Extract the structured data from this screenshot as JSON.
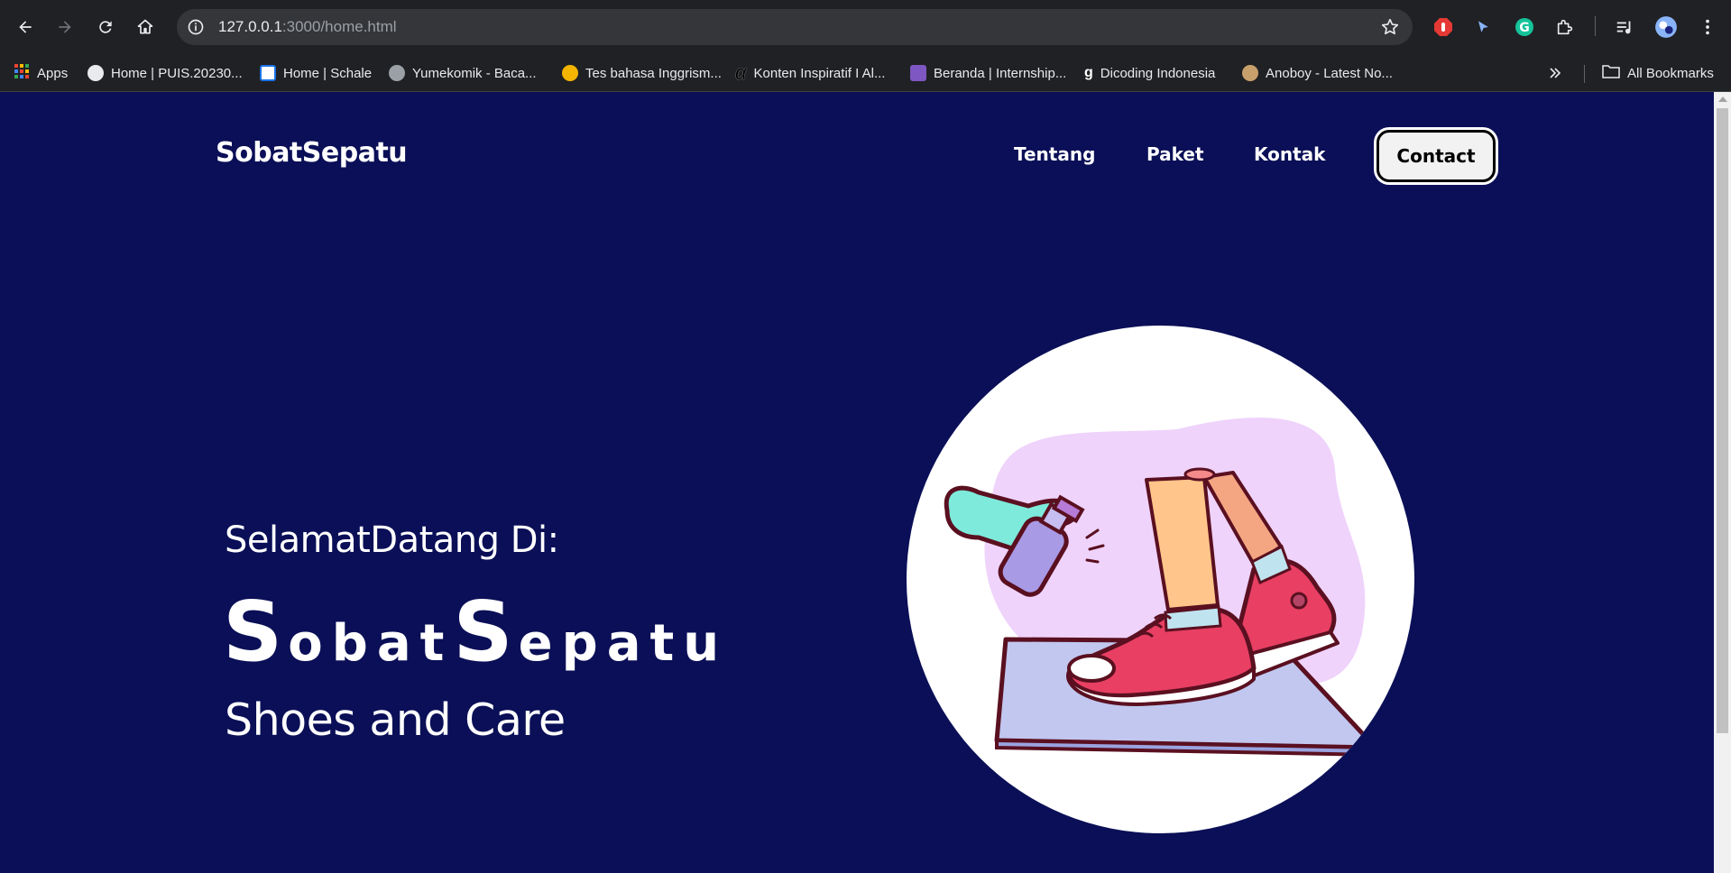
{
  "browser": {
    "url_host": "127.0.0.1",
    "url_path": ":3000/home.html",
    "bookmarks": [
      {
        "label": "Apps",
        "color": "#4285f4"
      },
      {
        "label": "Home | PUIS.20230...",
        "color": "#e8eaed"
      },
      {
        "label": "Home | Schale",
        "color": "#1a73e8"
      },
      {
        "label": "Yumekomik - Baca...",
        "color": "#9aa0a6"
      },
      {
        "label": "Tes bahasa Inggrism...",
        "color": "#f4b400"
      },
      {
        "label": "Konten Inspiratif I Al...",
        "color": "#000000"
      },
      {
        "label": "Beranda | Internship...",
        "color": "#7e57c2"
      },
      {
        "label": "Dicoding Indonesia",
        "color": "#ffffff"
      },
      {
        "label": "Anoboy - Latest No...",
        "color": "#c8a06b"
      }
    ],
    "all_bookmarks": "All Bookmarks"
  },
  "site": {
    "brand": "SobatSepatu",
    "nav": [
      "Tentang",
      "Paket",
      "Kontak"
    ],
    "contact_button": "Contact",
    "hero": {
      "welcome": "SelamatDatang Di:",
      "title_part1_big": "S",
      "title_part1_rest": "obat",
      "title_part2_big": "S",
      "title_part2_rest": "epatu",
      "tagline": "Shoes and Care"
    }
  },
  "colors": {
    "page_bg": "#0a0f57",
    "text": "#ffffff",
    "button_bg": "#f2f2f2"
  }
}
